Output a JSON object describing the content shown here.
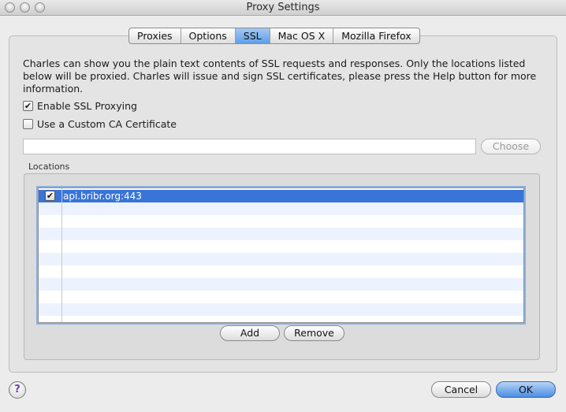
{
  "window": {
    "title": "Proxy Settings"
  },
  "tabs": [
    {
      "label": "Proxies",
      "active": false
    },
    {
      "label": "Options",
      "active": false
    },
    {
      "label": "SSL",
      "active": true
    },
    {
      "label": "Mac OS X",
      "active": false
    },
    {
      "label": "Mozilla Firefox",
      "active": false
    }
  ],
  "ssl": {
    "description": "Charles can show you the plain text contents of SSL requests and responses. Only the locations listed below will be proxied. Charles will issue and sign SSL certificates, please press the Help button for more information.",
    "enable_proxying": {
      "label": "Enable SSL Proxying",
      "checked": true
    },
    "custom_ca": {
      "label": "Use a Custom CA Certificate",
      "checked": false
    },
    "ca_path": {
      "value": "",
      "placeholder": ""
    },
    "choose_label": "Choose",
    "locations": {
      "label": "Locations",
      "rows": [
        {
          "checked": true,
          "value": "api.bribr.org:443",
          "selected": true
        }
      ],
      "add_label": "Add",
      "remove_label": "Remove"
    }
  },
  "footer": {
    "help_symbol": "?",
    "cancel_label": "Cancel",
    "ok_label": "OK"
  },
  "colors": {
    "selection": "#3875d7",
    "tab_active": "#5f9ee8",
    "default_button": "#4a8de3"
  },
  "icons": {
    "window_buttons": [
      "close-icon",
      "minimize-icon",
      "zoom-icon"
    ],
    "help": "help-icon"
  }
}
